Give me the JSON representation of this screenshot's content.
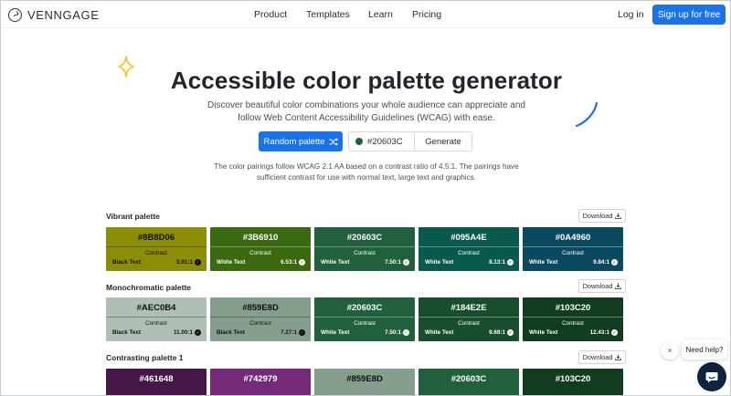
{
  "nav": {
    "logo": "VENNGAGE",
    "links": [
      "Product",
      "Templates",
      "Learn",
      "Pricing"
    ],
    "login": "Log in",
    "signup": "Sign up for free"
  },
  "hero": {
    "title": "Accessible color palette generator",
    "subtitle": "Discover beautiful color combinations your whole audience can appreciate and follow Web Content Accessibility Guidelines (WCAG) with ease.",
    "random_button": "Random palette",
    "hex_value": "#20603C",
    "hex_color": "#20603C",
    "generate_button": "Generate",
    "note": "The color pairings follow WCAG 2.1 AA based on a contrast ratio of 4.5:1. The pairings have sufficient contrast for use with normal text, large text and graphics."
  },
  "palettes": [
    {
      "title": "Vibrant palette",
      "download": "Download",
      "swatches": [
        {
          "hex": "#8B8D06",
          "color": "#8B8D06",
          "text_color": "#111111",
          "contrast_label": "Contrast",
          "text_label": "Black Text",
          "ratio": "5.91:1"
        },
        {
          "hex": "#3B6910",
          "color": "#3B6910",
          "text_color": "#ffffff",
          "contrast_label": "Contrast",
          "text_label": "White Text",
          "ratio": "6.53:1"
        },
        {
          "hex": "#20603C",
          "color": "#20603C",
          "text_color": "#ffffff",
          "contrast_label": "Contrast",
          "text_label": "White Text",
          "ratio": "7.50:1"
        },
        {
          "hex": "#095A4E",
          "color": "#095A4E",
          "text_color": "#ffffff",
          "contrast_label": "Contrast",
          "text_label": "White Text",
          "ratio": "8.13:1"
        },
        {
          "hex": "#0A4960",
          "color": "#0A4960",
          "text_color": "#ffffff",
          "contrast_label": "Contrast",
          "text_label": "White Text",
          "ratio": "9.84:1"
        }
      ]
    },
    {
      "title": "Monochromatic palette",
      "download": "Download",
      "swatches": [
        {
          "hex": "#AEC0B4",
          "color": "#AEC0B4",
          "text_color": "#111111",
          "contrast_label": "Contrast",
          "text_label": "Black Text",
          "ratio": "11.00:1"
        },
        {
          "hex": "#859E8D",
          "color": "#859E8D",
          "text_color": "#111111",
          "contrast_label": "Contrast",
          "text_label": "Black Text",
          "ratio": "7.27:1"
        },
        {
          "hex": "#20603C",
          "color": "#20603C",
          "text_color": "#ffffff",
          "contrast_label": "Contrast",
          "text_label": "White Text",
          "ratio": "7.50:1"
        },
        {
          "hex": "#184E2E",
          "color": "#184E2E",
          "text_color": "#ffffff",
          "contrast_label": "Contrast",
          "text_label": "White Text",
          "ratio": "9.69:1"
        },
        {
          "hex": "#103C20",
          "color": "#103C20",
          "text_color": "#ffffff",
          "contrast_label": "Contrast",
          "text_label": "White Text",
          "ratio": "12.43:1"
        }
      ]
    },
    {
      "title": "Contrasting palette 1",
      "download": "Download",
      "swatches": [
        {
          "hex": "#461648",
          "color": "#461648",
          "text_color": "#ffffff"
        },
        {
          "hex": "#742979",
          "color": "#742979",
          "text_color": "#ffffff"
        },
        {
          "hex": "#859E8D",
          "color": "#859E8D",
          "text_color": "#111111"
        },
        {
          "hex": "#20603C",
          "color": "#20603C",
          "text_color": "#ffffff"
        },
        {
          "hex": "#103C20",
          "color": "#103C20",
          "text_color": "#ffffff"
        }
      ]
    }
  ],
  "help": {
    "label": "Need help?",
    "close": "×"
  },
  "colors": {
    "accent": "#1a73e8",
    "chat_button": "#0e2340"
  }
}
